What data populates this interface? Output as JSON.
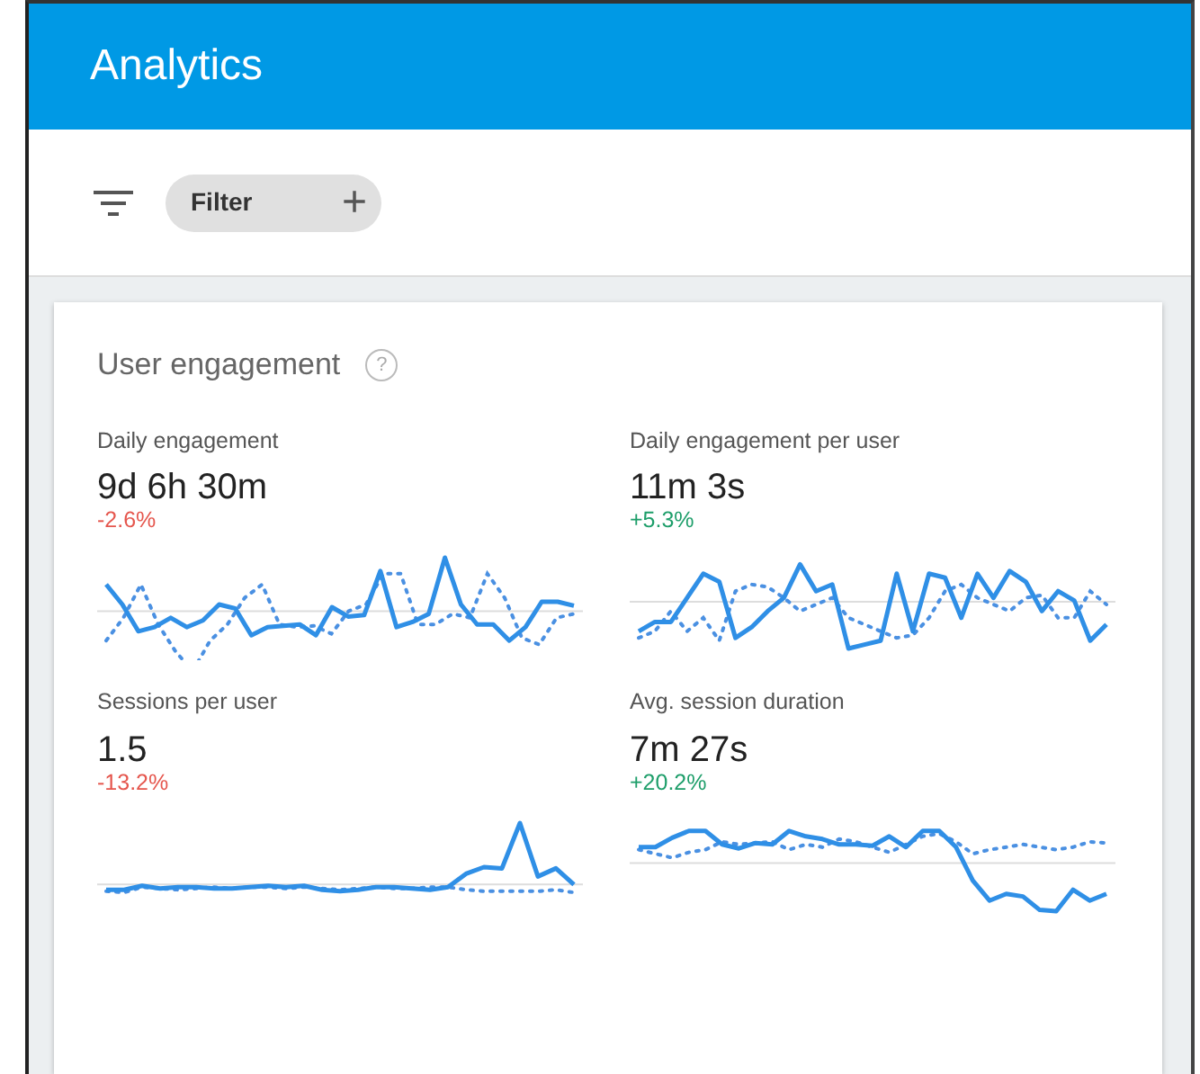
{
  "app_bar": {
    "title": "Analytics"
  },
  "filter_bar": {
    "chip_label": "Filter",
    "chip_action": "+"
  },
  "card": {
    "title": "User engagement",
    "help": "?",
    "metrics": [
      {
        "label": "Daily engagement",
        "value": "9d 6h 30m",
        "change": "-2.6%",
        "color": "#e5564d"
      },
      {
        "label": "Daily engagement per user",
        "value": "11m 3s",
        "change": "+5.3%",
        "color": "#1e9e6a"
      },
      {
        "label": "Sessions per user",
        "value": "1.5",
        "change": "-13.2%",
        "color": "#e5564d"
      },
      {
        "label": "Avg. session duration",
        "value": "7m 27s",
        "change": "+20.2%",
        "color": "#1e9e6a"
      }
    ]
  }
}
